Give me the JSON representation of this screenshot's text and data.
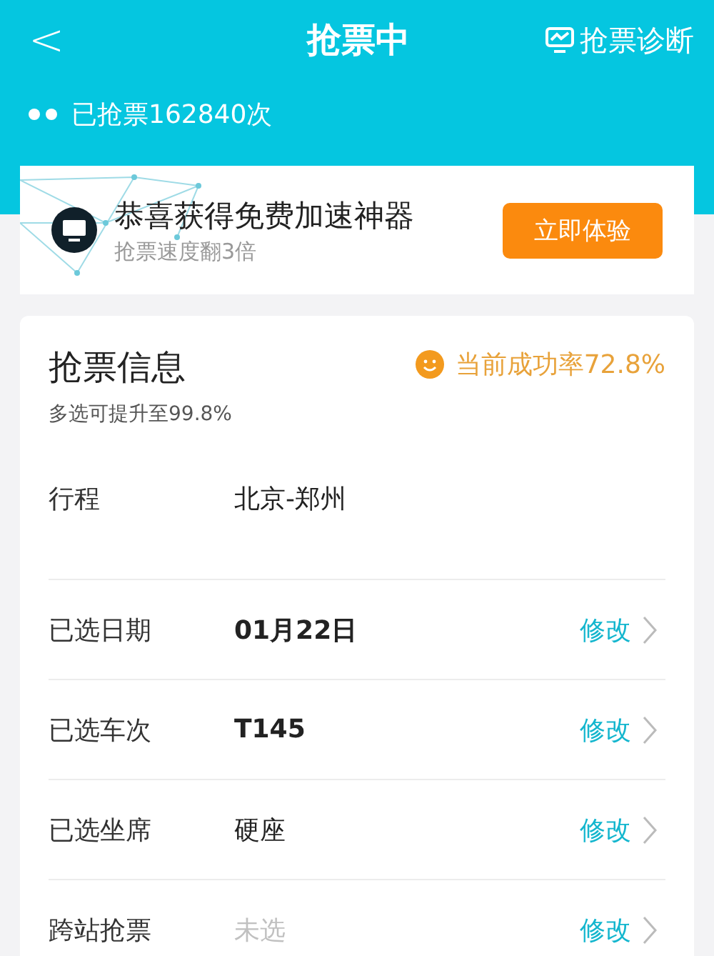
{
  "header": {
    "back": "<",
    "title": "抢票中",
    "diagnose": "抢票诊断",
    "counter": "已抢票162840次"
  },
  "promo": {
    "title": "恭喜获得免费加速神器",
    "subtitle": "抢票速度翻3倍",
    "button": "立即体验"
  },
  "info": {
    "title": "抢票信息",
    "subtitle": "多选可提升至99.8%",
    "rate": "当前成功率72.8%",
    "rows": [
      {
        "label": "行程",
        "value": "北京-郑州",
        "kind": "plain"
      },
      {
        "label": "已选日期",
        "value": "01月22日",
        "kind": "bold",
        "action": "修改"
      },
      {
        "label": "已选车次",
        "value": "T145",
        "kind": "bold",
        "action": "修改"
      },
      {
        "label": "已选坐席",
        "value": "硬座",
        "kind": "plain",
        "action": "修改"
      },
      {
        "label": "跨站抢票",
        "value": "未选",
        "kind": "muted",
        "action": "修改"
      }
    ]
  }
}
